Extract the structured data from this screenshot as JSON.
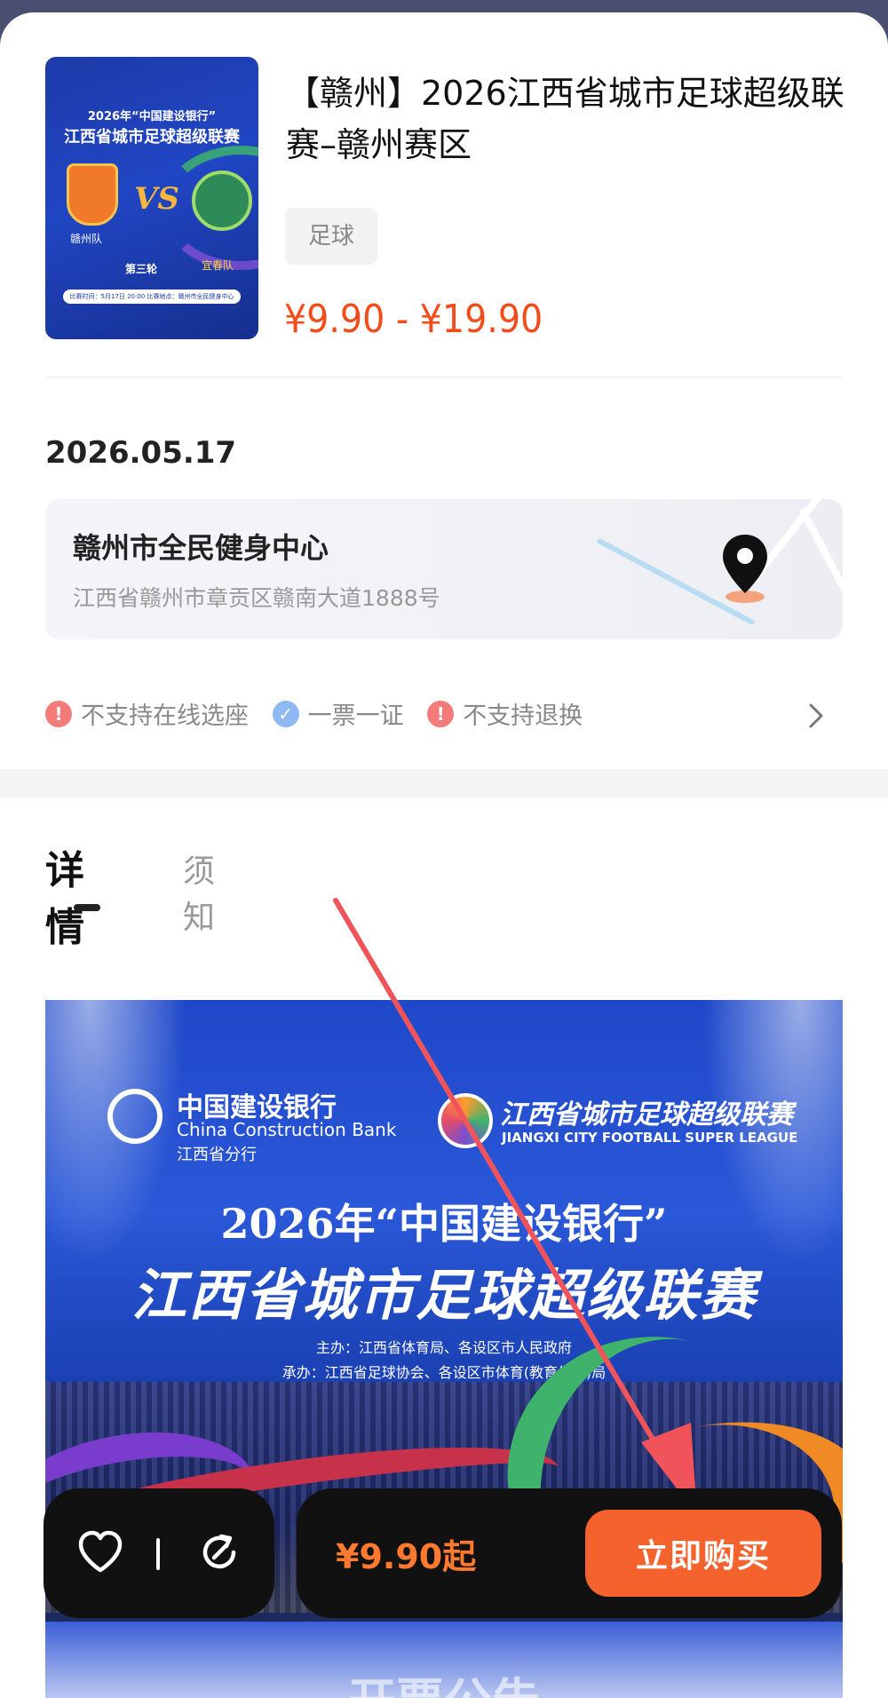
{
  "event": {
    "title": "【赣州】2026江西省城市足球超级联赛–赣州赛区",
    "tag": "足球",
    "price_range": "¥9.90 - ¥19.90",
    "date": "2026.05.17"
  },
  "poster_thumb": {
    "title_line1": "2026年“中国建设银行”",
    "title_line2": "江西省城市足球超级联赛",
    "team_home": "赣州队",
    "team_away": "宜春队",
    "vs": "VS",
    "round": "第三轮",
    "info": "比赛时间：5月17日 20:00  比赛地点：赣州市全民健身中心"
  },
  "venue": {
    "name": "赣州市全民健身中心",
    "address": "江西省赣州市章贡区赣南大道1888号",
    "icon": "map-pin-icon"
  },
  "notices": [
    {
      "label": "不支持在线选座",
      "icon": "warning-icon",
      "status_color": "#f57b7b",
      "glyph": "!"
    },
    {
      "label": "一票一证",
      "icon": "check-icon",
      "status_color": "#8fb9f3",
      "glyph": "✓"
    },
    {
      "label": "不支持退换",
      "icon": "warning-icon",
      "status_color": "#f57b7b",
      "glyph": "!"
    }
  ],
  "tabs": [
    {
      "label": "详情",
      "active": true
    },
    {
      "label": "须知",
      "active": false
    }
  ],
  "detail_poster": {
    "bank_cn": "中国建设银行",
    "bank_en": "China Construction Bank",
    "bank_branch": "江西省分行",
    "league_cn": "江西省城市足球超级联赛",
    "league_en": "JIANGXI CITY FOOTBALL SUPER LEAGUE",
    "headline1": "2026年“中国建设银行”",
    "headline2": "江西省城市足球超级联赛",
    "host": "主办：江西省体育局、各设区市人民政府",
    "organizer": "承办：江西省足球协会、各设区市体育(教育体育)局",
    "bottom_text": "开票公告"
  },
  "bottom_bar": {
    "favorite_icon": "heart-icon",
    "share_icon": "share-icon",
    "from_price": "¥9.90起",
    "buy_label": "立即购买"
  },
  "colors": {
    "price": "#f24c1a",
    "buy_button": "#f4622d",
    "bar_bg": "#111111",
    "annotation_arrow": "#f0545a"
  }
}
